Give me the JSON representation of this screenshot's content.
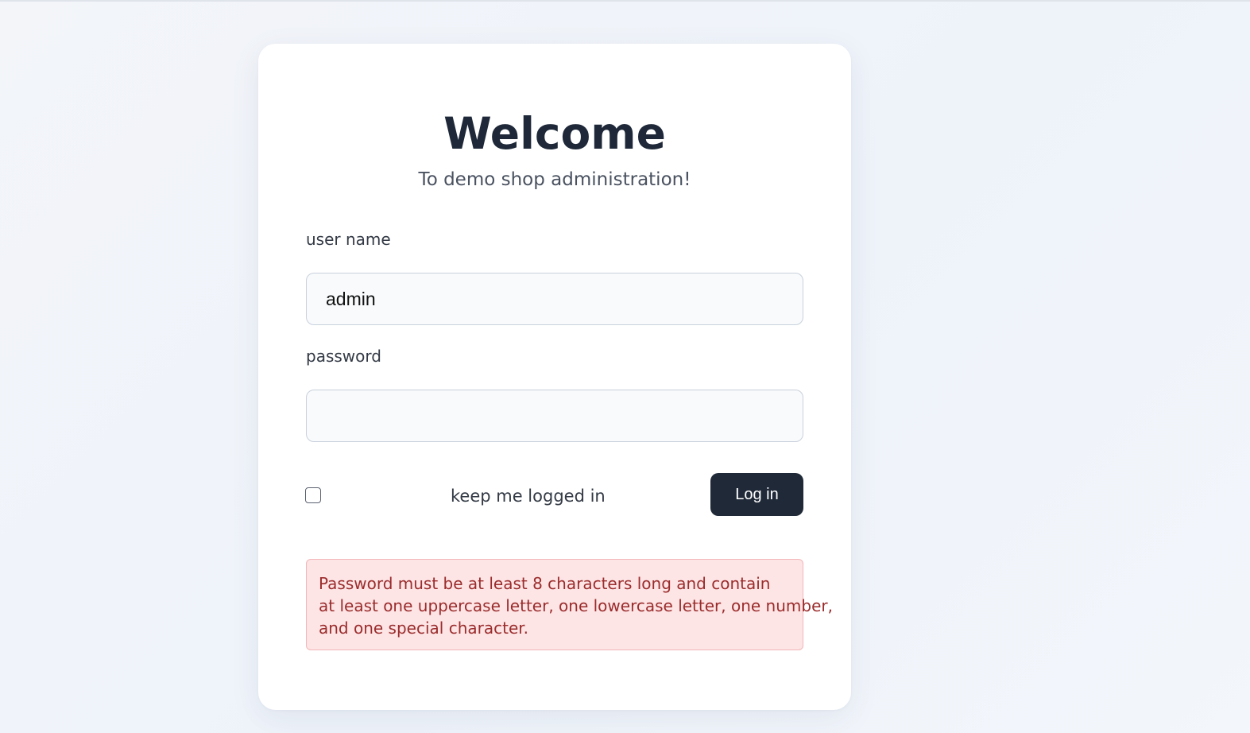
{
  "card": {
    "title": "Welcome",
    "subtitle": "To demo shop administration!"
  },
  "form": {
    "username_label": "user name",
    "username_value": "admin",
    "password_label": "password",
    "password_value": "",
    "remember_label": "keep me logged in",
    "remember_checked": false,
    "submit_label": "Log in"
  },
  "error": {
    "lines": [
      "Password must be at least 8 characters long and contain",
      "at least one uppercase letter, one lowercase letter, one number,",
      "and one special character."
    ]
  },
  "colors": {
    "button_bg": "#1f2937",
    "error_bg": "#fde4e5",
    "error_text": "#9b2c2c",
    "title_text": "#1e2838"
  }
}
